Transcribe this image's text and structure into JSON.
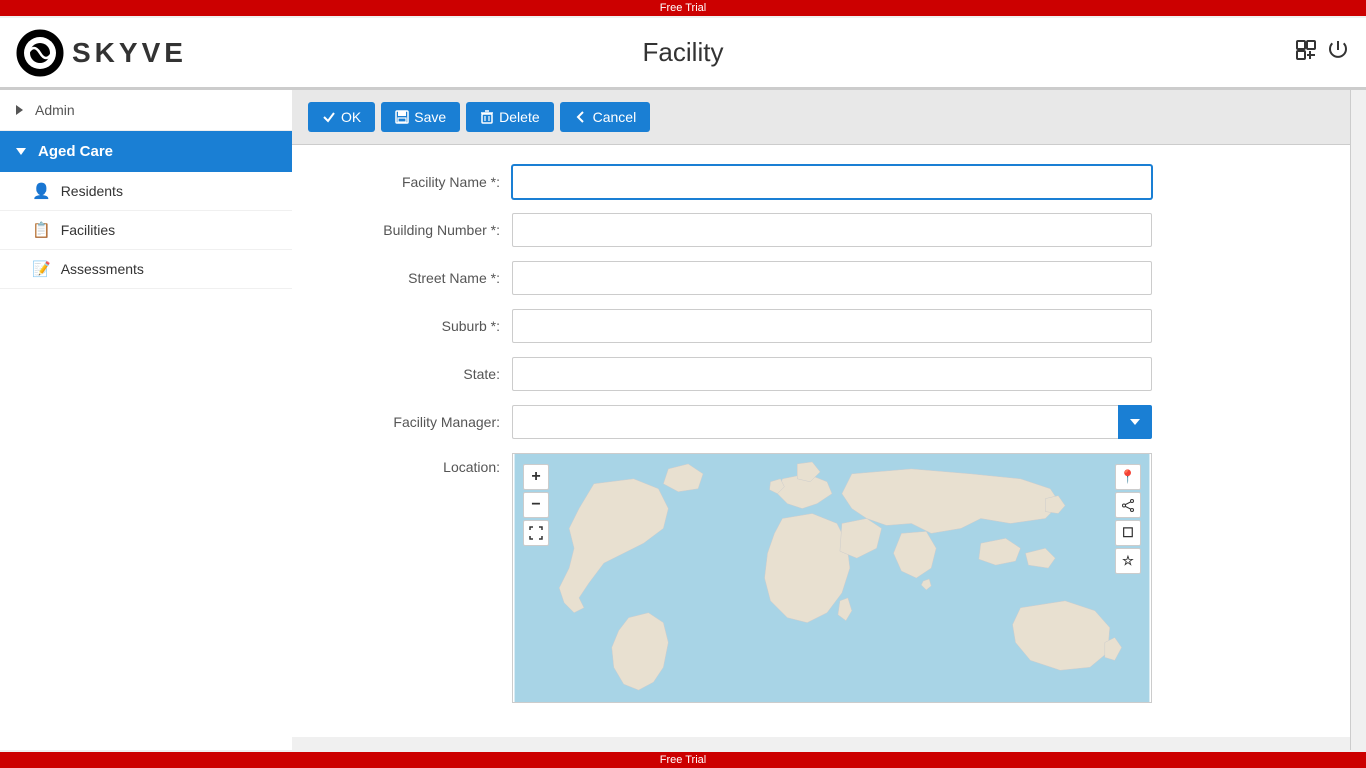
{
  "freeTrial": {
    "label": "Free Trial"
  },
  "header": {
    "logoText": "SKYVE",
    "title": "Facility",
    "icons": {
      "switch": "⎘",
      "power": "⏻"
    }
  },
  "sidebar": {
    "adminLabel": "Admin",
    "agedCareLabel": "Aged Care",
    "items": [
      {
        "id": "residents",
        "label": "Residents",
        "icon": "person"
      },
      {
        "id": "facilities",
        "label": "Facilities",
        "icon": "grid"
      },
      {
        "id": "assessments",
        "label": "Assessments",
        "icon": "clipboard"
      }
    ]
  },
  "toolbar": {
    "okLabel": "OK",
    "saveLabel": "Save",
    "deleteLabel": "Delete",
    "cancelLabel": "Cancel"
  },
  "form": {
    "facilityNameLabel": "Facility Name *:",
    "buildingNumberLabel": "Building Number *:",
    "streetNameLabel": "Street Name *:",
    "suburbLabel": "Suburb *:",
    "stateLabel": "State:",
    "facilityManagerLabel": "Facility Manager:",
    "locationLabel": "Location:",
    "facilityNameValue": "",
    "buildingNumberValue": "",
    "streetNameValue": "",
    "suburbValue": "",
    "stateValue": "",
    "facilityManagerValue": ""
  },
  "map": {
    "zoomIn": "+",
    "zoomOut": "−",
    "fullscreen": "⛶",
    "pin": "📍",
    "share": "⤢",
    "layers": "☐",
    "star": "☆"
  }
}
